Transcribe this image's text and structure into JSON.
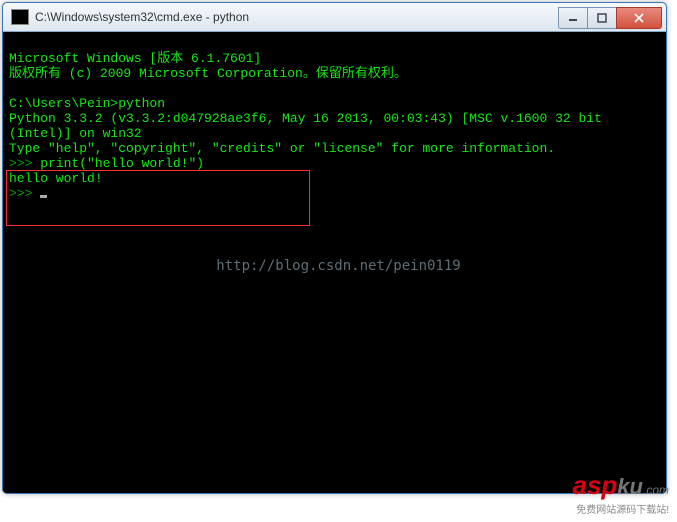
{
  "window": {
    "title": "C:\\Windows\\system32\\cmd.exe - python"
  },
  "terminal": {
    "line1": "Microsoft Windows [版本 6.1.7601]",
    "line2": "版权所有 (c) 2009 Microsoft Corporation。保留所有权利。",
    "blank1": "",
    "line3": "C:\\Users\\Pein>python",
    "line4": "Python 3.3.2 (v3.3.2:d047928ae3f6, May 16 2013, 00:03:43) [MSC v.1600 32 bit (Intel)] on win32",
    "line5": "Type \"help\", \"copyright\", \"credits\" or \"license\" for more information.",
    "line6_prompt": ">>> ",
    "line6_cmd": "print(\"hello world!\")",
    "line7": "hello world!",
    "line8_prompt": ">>> "
  },
  "watermark": {
    "center": "http://blog.csdn.net/pein0119",
    "logo_a": "asp",
    "logo_b": "ku",
    "logo_dot": ".com",
    "logo_sub": "免费网站源码下载站!"
  }
}
